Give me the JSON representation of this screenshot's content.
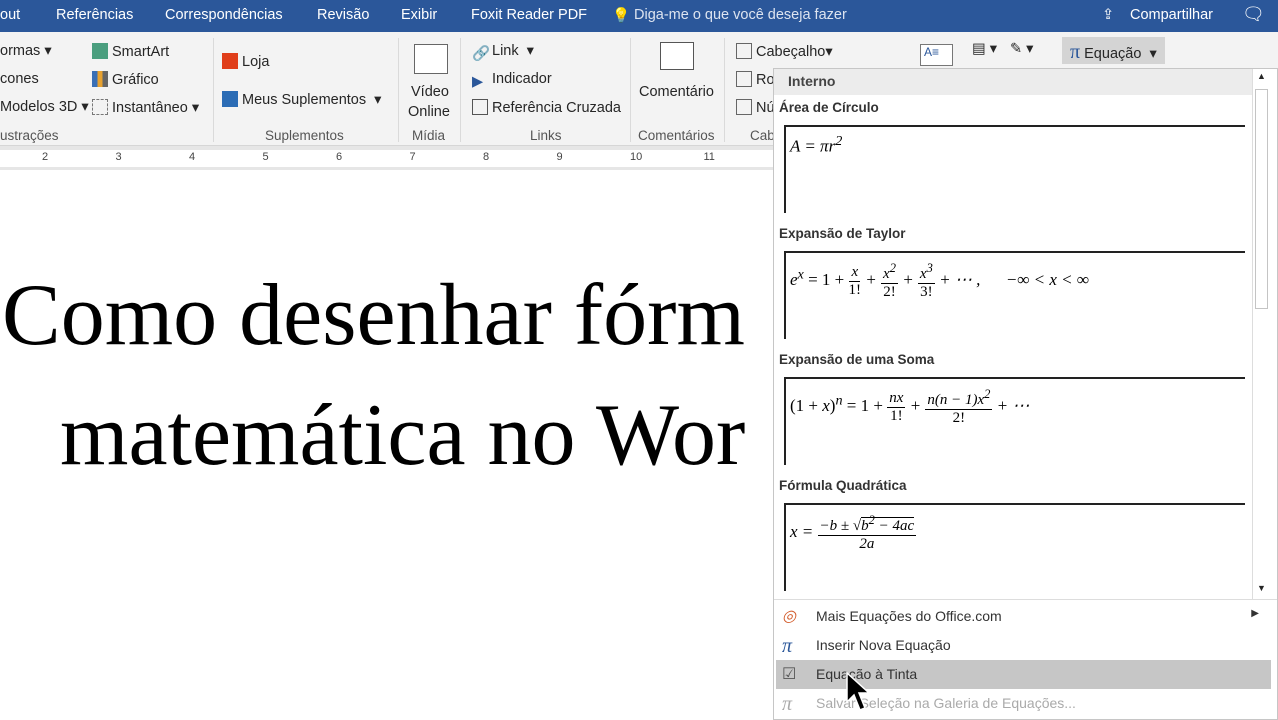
{
  "tabs": [
    "out",
    "Referências",
    "Correspondências",
    "Revisão",
    "Exibir",
    "Foxit Reader PDF"
  ],
  "tell_me": "Diga-me o que você deseja fazer",
  "share": "Compartilhar",
  "ribbon": {
    "formas": "ormas",
    "icones": "cones",
    "modelos": "Modelos 3D",
    "smartart": "SmartArt",
    "grafico": "Gráfico",
    "instantaneo": "Instantâneo",
    "ilustracoes": "ustrações",
    "loja": "Loja",
    "meus": "Meus Suplementos",
    "suplementos": "Suplementos",
    "video1": "Vídeo",
    "video2": "Online",
    "midia": "Mídia",
    "link": "Link",
    "indicador": "Indicador",
    "refcruz": "Referência Cruzada",
    "links": "Links",
    "comentario": "Comentário",
    "comentarios": "Comentários",
    "cabecalho": "Cabeçalho",
    "rodape": "Ro",
    "numero": "Nú",
    "cab": "Cab",
    "equacao": "Equação"
  },
  "ruler": [
    "2",
    "3",
    "4",
    "5",
    "6",
    "7",
    "8",
    "9",
    "10",
    "11"
  ],
  "doc": {
    "line1": "Como desenhar fórm",
    "line2": "matemática no Wor"
  },
  "panel": {
    "header": "Interno",
    "equations": [
      {
        "name": "Área de Círculo"
      },
      {
        "name": "Expansão de Taylor"
      },
      {
        "name": "Expansão de uma Soma"
      },
      {
        "name": "Fórmula Quadrática"
      }
    ],
    "menu": [
      {
        "label": "Mais Equações do Office.com"
      },
      {
        "label": "Inserir Nova Equação"
      },
      {
        "label": "Equação à Tinta"
      },
      {
        "label": "Salvar Seleção na Galeria de Equações..."
      }
    ]
  }
}
